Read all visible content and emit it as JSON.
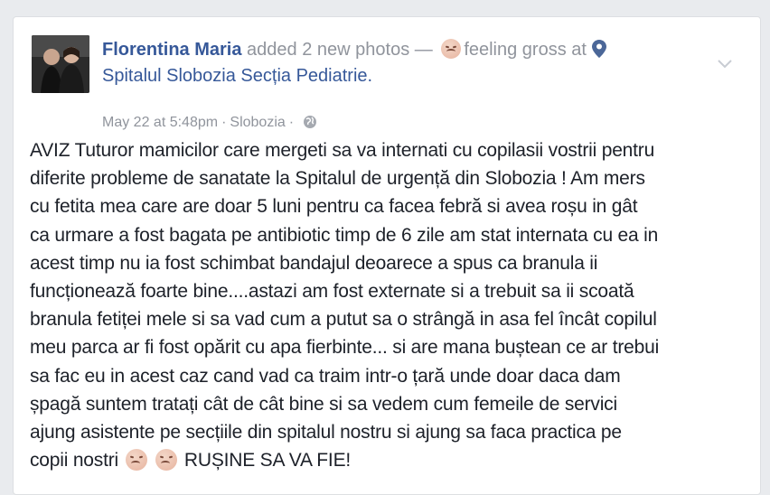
{
  "post": {
    "author": "Florentina Maria",
    "action_text": " added 2 new photos — ",
    "feeling_icon": "sick-face-emoji",
    "feeling_text": "feeling gross at",
    "location_icon": "location-pin-icon",
    "place": "Spitalul Slobozia Secția Pediatrie.",
    "timestamp": "May 22 at 5:48pm",
    "separator": "·",
    "location": "Slobozia",
    "privacy_icon": "globe-icon",
    "menu_icon": "chevron-down-icon",
    "lines": [
      "AVIZ Tuturor mamicilor care mergeti sa va internati cu copilasii vostrii pentru",
      "diferite probleme de sanatate la Spitalul de urgență din Slobozia ! Am mers",
      "cu fetita mea care are doar 5 luni pentru ca facea febră si avea roșu in gât",
      "ca urmare a fost bagata pe antibiotic timp de 6 zile am stat internata cu ea in",
      "acest timp nu ia fost schimbat bandajul deoarece a spus ca branula ii",
      "funcționează foarte bine....astazi am fost externate si a trebuit sa ii scoată",
      "branula fetiței mele si sa vad cum a putut sa o strângă in asa fel încât copilul",
      "meu parca ar fi fost opărit cu apa fierbinte... si are mana buștean ce ar trebui",
      "sa fac eu in acest caz cand vad ca traim intr-o țară unde doar daca dam",
      "șpagă suntem tratați cât de cât bine si sa vedem cum femeile de servici",
      "ajung asistente pe secțiile din spitalul nostru si ajung sa faca practica pe"
    ],
    "last_line_start": "copii nostri",
    "last_line_end": "RUȘINE SA VA FIE!"
  },
  "colors": {
    "link": "#365899",
    "meta": "#90949c",
    "text": "#1d2129",
    "background": "#e9ebee"
  }
}
